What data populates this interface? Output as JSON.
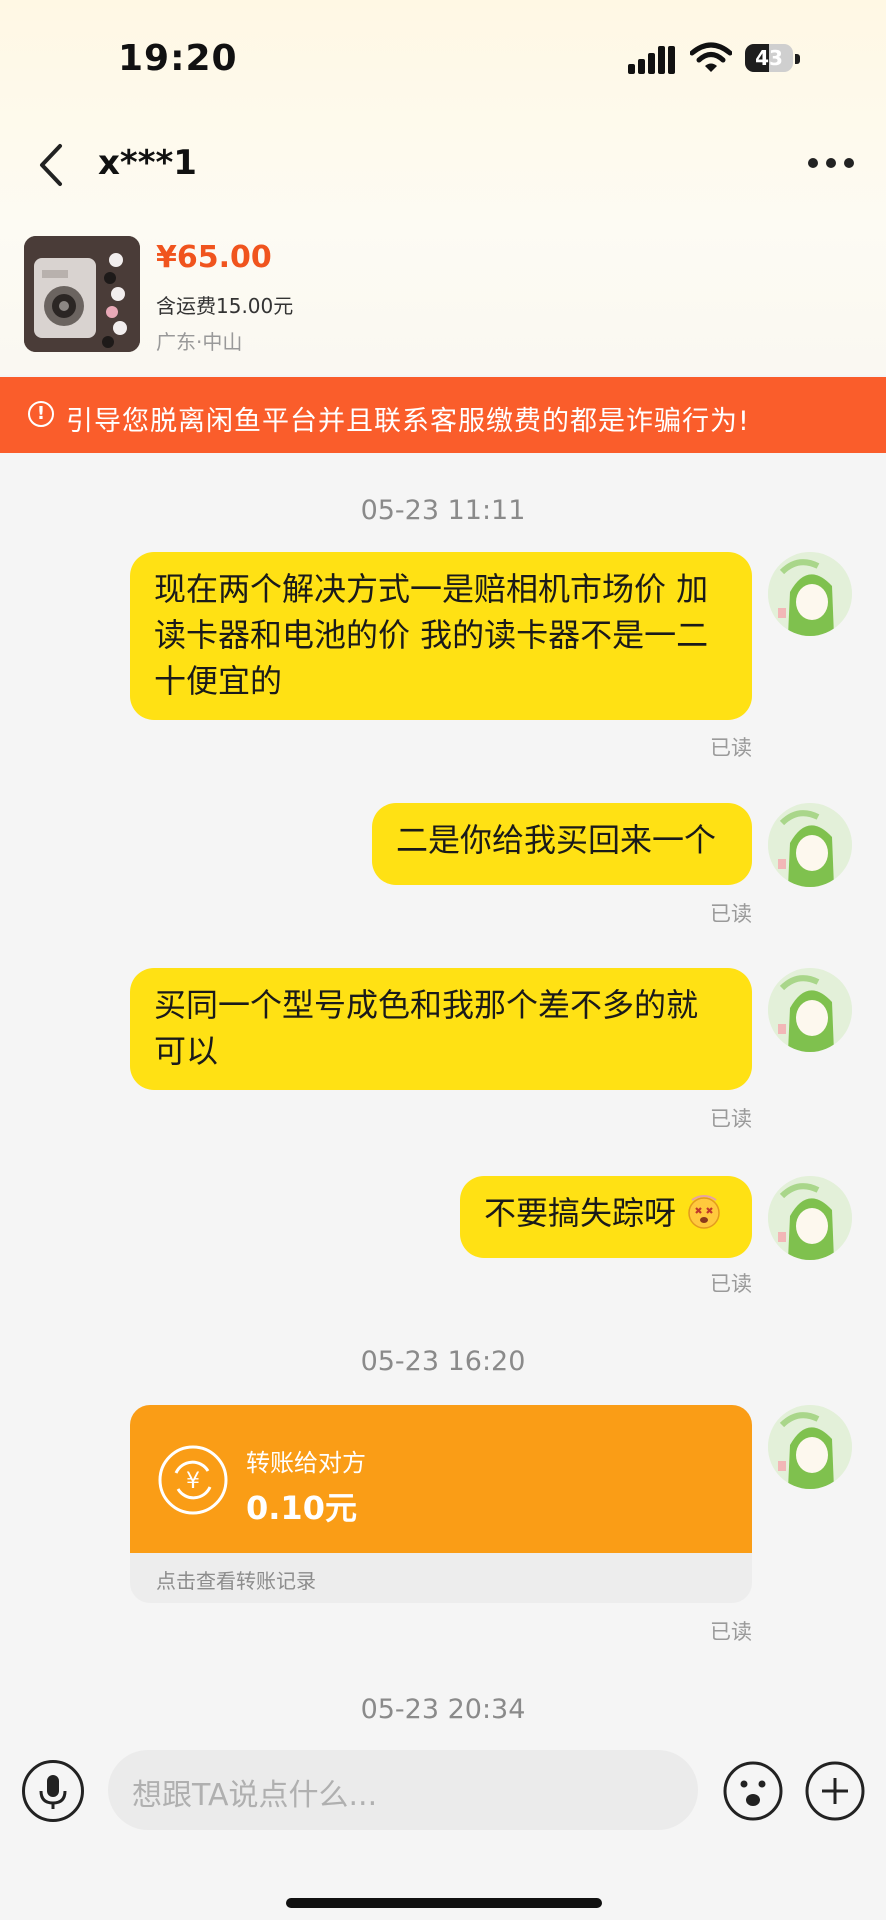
{
  "status_bar": {
    "time": "19:20",
    "battery": "43"
  },
  "header": {
    "title": "x***1"
  },
  "product": {
    "price": "¥65.00",
    "shipping": "含运费15.00元",
    "location": "广东·中山"
  },
  "warning": {
    "text": "引导您脱离闲鱼平台并且联系客服缴费的都是诈骗行为!"
  },
  "timestamps": [
    "05-23 11:11",
    "05-23 16:20",
    "05-23 20:34"
  ],
  "messages": [
    {
      "lines": [
        "现在两个解决方式一是赔相机市场价 加",
        "读卡器和电池的价 我的读卡器不是一二",
        "十便宜的"
      ],
      "status": "已读"
    },
    {
      "lines": [
        "二是你给我买回来一个"
      ],
      "status": "已读"
    },
    {
      "lines": [
        "买同一个型号成色和我那个差不多的就",
        "可以"
      ],
      "status": "已读"
    },
    {
      "lines": [
        "不要搞失踪呀"
      ],
      "emoji": "dizzy-face-emoji",
      "status": "已读"
    }
  ],
  "transfer": {
    "label": "转账给对方",
    "amount": "0.10元",
    "link": "点击查看转账记录",
    "status": "已读"
  },
  "composer": {
    "placeholder": "想跟TA说点什么..."
  },
  "colors": {
    "bubble": "#ffe114",
    "accent": "#f0541e",
    "warning_bg": "#fa5d2b",
    "transfer": "#fa9d16"
  }
}
